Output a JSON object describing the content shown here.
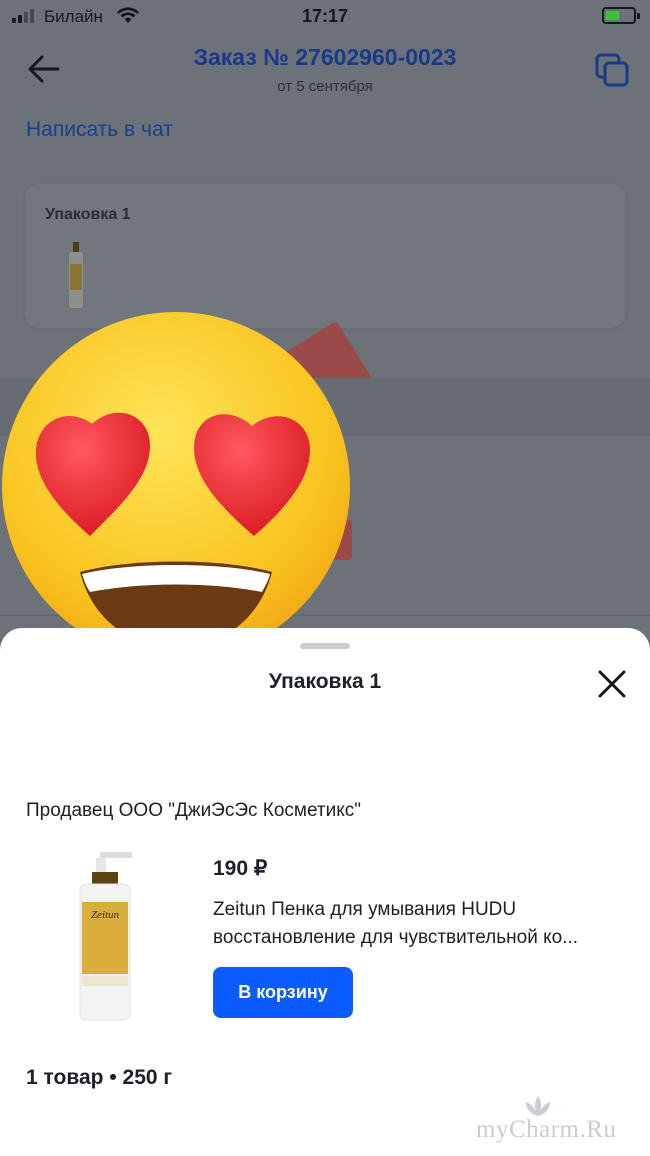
{
  "status_bar": {
    "carrier": "Билайн",
    "time": "17:17"
  },
  "header": {
    "title": "Заказ № 27602960-0023",
    "subtitle": "от 5 сентября",
    "chat_link": "Написать в чат"
  },
  "package_card": {
    "title": "Упаковка 1"
  },
  "sheet": {
    "title": "Упаковка 1",
    "seller": "Продавец ООО \"ДжиЭсЭс Косметикс\"",
    "product": {
      "price": "190 ₽",
      "name_line1": "Zeitun Пенка для умывания HUDU",
      "name_line2": "восстановление для чувствительной ко...",
      "cart_button": "В корзину",
      "brand_on_bottle": "Zeitun"
    },
    "summary": "1 товар • 250 г"
  },
  "watermark": "myCharm.Ru",
  "colors": {
    "accent": "#0a5cff",
    "title_blue": "#173a8a",
    "dim_overlay": "#6d7178"
  },
  "icons": [
    "back-arrow-icon",
    "copy-icon",
    "close-icon",
    "wifi-icon",
    "battery-icon",
    "heart-eyes-emoji"
  ]
}
